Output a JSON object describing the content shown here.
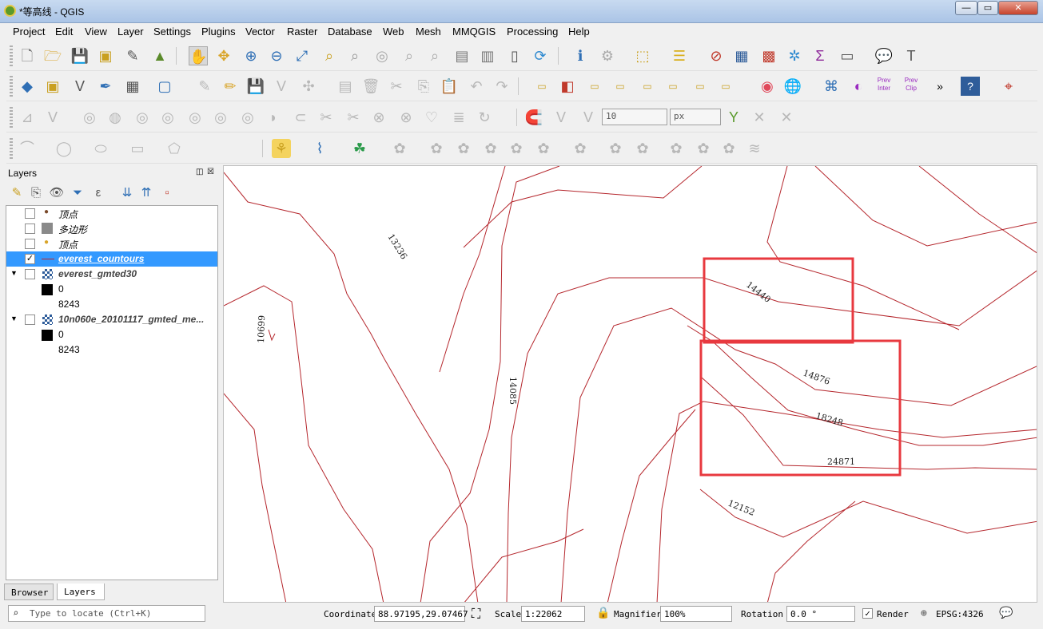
{
  "window": {
    "title": "*等高线 - QGIS",
    "btn_min": "—",
    "btn_max": "▭",
    "btn_close": "✕"
  },
  "menu": [
    "Project",
    "Edit",
    "View",
    "Layer",
    "Settings",
    "Plugins",
    "Vector",
    "Raster",
    "Database",
    "Web",
    "Mesh",
    "MMQGIS",
    "Processing",
    "Help"
  ],
  "toolbar3": {
    "tolerance_value": "10",
    "unit_value": "px"
  },
  "toolbar2": {
    "more": "»"
  },
  "layers_panel": {
    "title": "Layers",
    "items": [
      {
        "name": "顶点",
        "checked": false
      },
      {
        "name": "多边形",
        "checked": false
      },
      {
        "name": "顶点",
        "checked": false
      },
      {
        "name": "everest_countours",
        "checked": true,
        "selected": true
      },
      {
        "name": "everest_gmted30",
        "checked": false,
        "legend_min": "0",
        "legend_max": "8243"
      },
      {
        "name": "10n060e_20101117_gmted_me...",
        "checked": false,
        "legend_min": "0",
        "legend_max": "8243"
      }
    ],
    "check_mark": "✓"
  },
  "tabs": {
    "browser": "Browser",
    "layers": "Layers"
  },
  "map": {
    "contour_color": "#b5272d",
    "highlight_color": "#e8393f",
    "labels": [
      "13236",
      "10699",
      "14085",
      "14440",
      "14876",
      "18248",
      "24871",
      "12152"
    ]
  },
  "status": {
    "locate_placeholder": "Type to locate (Ctrl+K)",
    "coordinate_label": "Coordinate",
    "coordinate_value": "88.97195,29.07467",
    "scale_label": "Scale",
    "scale_value": "1:22062",
    "magnifier_label": "Magnifier",
    "magnifier_value": "100%",
    "rotation_label": "Rotation",
    "rotation_value": "0.0 °",
    "render_label": "Render",
    "epsg": "EPSG:4326"
  }
}
